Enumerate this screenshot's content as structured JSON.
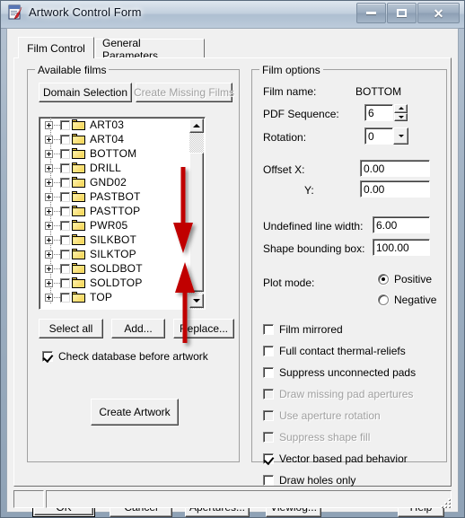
{
  "window": {
    "title": "Artwork Control Form",
    "icon": "artwork-form-icon",
    "controls": {
      "minimize": "Minimize",
      "maximize": "Maximize",
      "close": "Close"
    }
  },
  "tabs": [
    {
      "label": "Film Control",
      "active": true
    },
    {
      "label": "General Parameters",
      "active": false
    }
  ],
  "available_films": {
    "title": "Available films",
    "buttons": {
      "domain_selection": "Domain Selection",
      "create_missing_films": "Create Missing Films",
      "select_all": "Select all",
      "add": "Add...",
      "replace": "Replace...",
      "create_artwork": "Create Artwork"
    },
    "films": [
      "ART03",
      "ART04",
      "BOTTOM",
      "DRILL",
      "GND02",
      "PASTBOT",
      "PASTTOP",
      "PWR05",
      "SILKBOT",
      "SILKTOP",
      "SOLDBOT",
      "SOLDTOP",
      "TOP"
    ],
    "check_database": {
      "label": "Check database before artwork",
      "checked": true
    }
  },
  "film_options": {
    "title": "Film options",
    "film_name_label": "Film name:",
    "film_name_value": "BOTTOM",
    "pdf_sequence_label": "PDF Sequence:",
    "pdf_sequence_value": "6",
    "rotation_label": "Rotation:",
    "rotation_value": "0",
    "offset_label": "Offset  X:",
    "offset_x_value": "0.00",
    "offset_y_label": "Y:",
    "offset_y_value": "0.00",
    "undefined_line_width_label": "Undefined line width:",
    "undefined_line_width_value": "6.00",
    "shape_bounding_box_label": "Shape bounding box:",
    "shape_bounding_box_value": "100.00",
    "plot_mode_label": "Plot mode:",
    "plot_mode_positive": "Positive",
    "plot_mode_negative": "Negative",
    "checkboxes": [
      {
        "label": "Film mirrored",
        "checked": false,
        "disabled": false
      },
      {
        "label": "Full contact thermal-reliefs",
        "checked": false,
        "disabled": false
      },
      {
        "label": "Suppress unconnected pads",
        "checked": false,
        "disabled": false
      },
      {
        "label": "Draw missing pad apertures",
        "checked": false,
        "disabled": true
      },
      {
        "label": "Use aperture rotation",
        "checked": false,
        "disabled": true
      },
      {
        "label": "Suppress shape fill",
        "checked": false,
        "disabled": true
      },
      {
        "label": "Vector based pad behavior",
        "checked": true,
        "disabled": false
      },
      {
        "label": "Draw holes only",
        "checked": false,
        "disabled": false
      }
    ]
  },
  "dialog_buttons": {
    "ok": "OK",
    "cancel": "Cancel",
    "apertures": "Apertures...",
    "viewlog": "Viewlog...",
    "help": "Help"
  },
  "status_bar": {
    "pane_left": "",
    "pane_right": ""
  },
  "annotations": {
    "arrow_down": "red-down-arrow",
    "arrow_up": "red-up-arrow",
    "color": "#c00000"
  }
}
